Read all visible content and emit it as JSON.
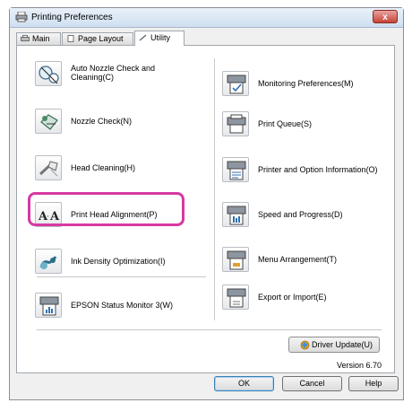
{
  "window": {
    "title": "Printing Preferences",
    "close_label": "x"
  },
  "tabs": [
    {
      "label": "Main",
      "icon": "printer-icon"
    },
    {
      "label": "Page Layout",
      "icon": "page-icon"
    },
    {
      "label": "Utility",
      "icon": "wrench-icon"
    }
  ],
  "left_items": [
    {
      "label": "Auto Nozzle Check and Cleaning(C)",
      "icon": "auto-nozzle-icon"
    },
    {
      "label": "Nozzle Check(N)",
      "icon": "nozzle-check-icon"
    },
    {
      "label": "Head Cleaning(H)",
      "icon": "head-cleaning-icon"
    },
    {
      "label": "Print Head Alignment(P)",
      "icon": "head-alignment-icon"
    },
    {
      "label": "Ink Density Optimization(I)",
      "icon": "ink-density-icon"
    },
    {
      "label": "EPSON Status Monitor 3(W)",
      "icon": "status-monitor-icon"
    }
  ],
  "right_items": [
    {
      "label": "Monitoring Preferences(M)",
      "icon": "monitoring-icon"
    },
    {
      "label": "Print Queue(S)",
      "icon": "print-queue-icon"
    },
    {
      "label": "Printer and Option Information(O)",
      "icon": "printer-info-icon"
    },
    {
      "label": "Speed and Progress(D)",
      "icon": "speed-progress-icon"
    },
    {
      "label": "Menu Arrangement(T)",
      "icon": "menu-arrangement-icon"
    },
    {
      "label": "Export or Import(E)",
      "icon": "export-import-icon"
    }
  ],
  "driver_update": {
    "label": "Driver Update(U)"
  },
  "version": "Version 6.70",
  "buttons": {
    "ok": "OK",
    "cancel": "Cancel",
    "help": "Help"
  },
  "colors": {
    "highlight": "#d63aa3",
    "title_bar": "#dce8f5"
  }
}
